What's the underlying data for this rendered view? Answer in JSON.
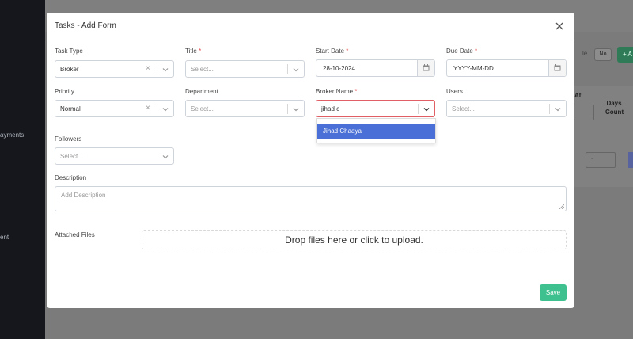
{
  "background": {
    "sidebar_items": [
      "ayments",
      "ent"
    ],
    "toggle_label": "le",
    "toggle_value": "No",
    "add_button": "+ A",
    "column_at": "At",
    "column_days": "Days Count",
    "days_value": "1"
  },
  "modal": {
    "title": "Tasks - Add Form",
    "fields": {
      "task_type": {
        "label": "Task Type",
        "value": "Broker"
      },
      "title": {
        "label": "Title",
        "placeholder": "Select..."
      },
      "start_date": {
        "label": "Start Date",
        "value": "28-10-2024"
      },
      "due_date": {
        "label": "Due Date",
        "placeholder": "YYYY-MM-DD"
      },
      "priority": {
        "label": "Priority",
        "value": "Normal"
      },
      "department": {
        "label": "Department",
        "placeholder": "Select..."
      },
      "broker_name": {
        "label": "Broker Name",
        "value": "jihad c",
        "options": [
          "Jihad Chaaya"
        ]
      },
      "users": {
        "label": "Users",
        "placeholder": "Select..."
      },
      "followers": {
        "label": "Followers",
        "placeholder": "Select..."
      },
      "description": {
        "label": "Description",
        "placeholder": "Add Description"
      },
      "attached_files": {
        "label": "Attached Files",
        "dropzone_text": "Drop files here or click to upload."
      }
    },
    "required_mark": "*",
    "clear_icon": "×",
    "save_label": "Save"
  },
  "colors": {
    "accent_save": "#3ec18f",
    "dropdown_highlight": "#4a6fd6",
    "required": "#e5484d",
    "focus_border": "#e06066"
  }
}
